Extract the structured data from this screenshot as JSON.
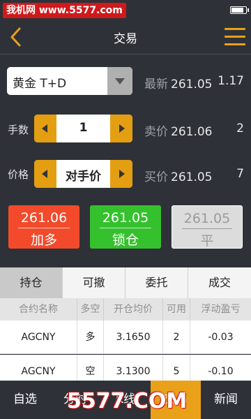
{
  "watermark": {
    "top": "我机网 www.5577.com",
    "bottom": "5577.COM"
  },
  "nav": {
    "title": "交易"
  },
  "instrument": {
    "selected": "黄金 T+D"
  },
  "quote": {
    "latest_label": "最新",
    "latest_value": "261.05",
    "latest_extra": "1.17",
    "ask_label": "卖价",
    "ask_value": "261.06",
    "ask_extra": "2",
    "bid_label": "买价",
    "bid_value": "261.05",
    "bid_extra": "7"
  },
  "lots": {
    "label": "手数",
    "value": "1"
  },
  "price": {
    "label": "价格",
    "value": "对手价"
  },
  "actions": {
    "buy": {
      "price": "261.06",
      "label": "加多"
    },
    "lock": {
      "price": "261.05",
      "label": "锁仓"
    },
    "close": {
      "price": "261.05",
      "label": "平"
    }
  },
  "tabs": [
    "持仓",
    "可撤",
    "委托",
    "成交"
  ],
  "table": {
    "headers": [
      "合约名称",
      "多空",
      "开仓均价",
      "可用",
      "浮动盈亏"
    ],
    "rows": [
      [
        "AGCNY",
        "多",
        "3.1650",
        "2",
        "-0.03"
      ],
      [
        "AGCNY",
        "空",
        "3.1300",
        "5",
        "-0.10"
      ]
    ]
  },
  "bottom_nav": [
    "自选",
    "分时",
    "K线",
    "交易",
    "新闻"
  ],
  "colors": {
    "accent": "#e9a11a",
    "red": "#f24a2b",
    "green": "#35c12d",
    "background": "#2e3137"
  }
}
